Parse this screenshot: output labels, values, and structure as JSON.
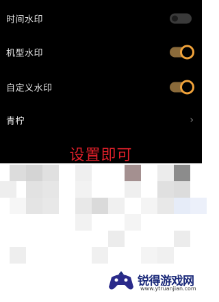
{
  "settings": {
    "items": [
      {
        "label": "时间水印",
        "toggle": "off"
      },
      {
        "label": "机型水印",
        "toggle": "on"
      },
      {
        "label": "自定义水印",
        "toggle": "on"
      },
      {
        "label": "青柠",
        "toggle": "chevron"
      }
    ],
    "accent_color": "#f0a23a"
  },
  "caption": {
    "text": "设置即可",
    "color": "#e0202a"
  },
  "watermark": {
    "name": "锐得游戏网",
    "url": "www.ytruanjian.com"
  }
}
